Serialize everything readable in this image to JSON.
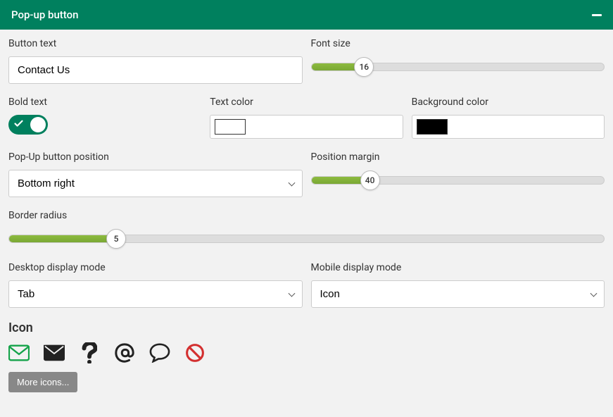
{
  "panel": {
    "title": "Pop-up button"
  },
  "buttonText": {
    "label": "Button text",
    "value": "Contact Us"
  },
  "fontSize": {
    "label": "Font size",
    "value": 16,
    "percent": 18
  },
  "boldText": {
    "label": "Bold text",
    "on": true
  },
  "textColor": {
    "label": "Text color",
    "value": "#ffffff"
  },
  "backgroundColor": {
    "label": "Background color",
    "value": "#000000"
  },
  "position": {
    "label": "Pop-Up button position",
    "value": "Bottom right"
  },
  "positionMargin": {
    "label": "Position margin",
    "value": 40,
    "percent": 20
  },
  "borderRadius": {
    "label": "Border radius",
    "value": 5,
    "percent": 18
  },
  "desktopMode": {
    "label": "Desktop display mode",
    "value": "Tab"
  },
  "mobileMode": {
    "label": "Mobile display mode",
    "value": "Icon"
  },
  "iconSection": {
    "title": "Icon"
  },
  "moreIcons": {
    "label": "More icons..."
  },
  "colors": {
    "accent": "#00805e",
    "sliderFill": "#8dbb3f",
    "selectedIcon": "#15a34a",
    "banIcon": "#d32f2f"
  }
}
